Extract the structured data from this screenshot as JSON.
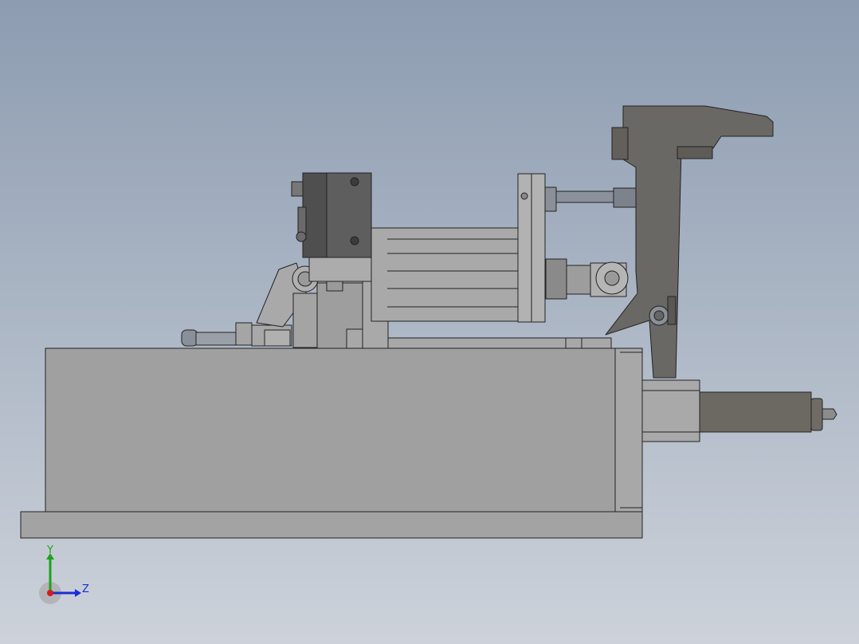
{
  "viewport": {
    "background_top": "#8d9cb1",
    "background_bottom": "#cdd2da"
  },
  "model": {
    "shade_color": "#9a9a9a",
    "dark_part_color": "#6a6864",
    "edge_color": "#222222"
  },
  "triad": {
    "y_label": "Y",
    "z_label": "Z",
    "y_color": "#1aa31a",
    "z_color": "#1a2dd6",
    "x_color": "#d41a1a"
  }
}
